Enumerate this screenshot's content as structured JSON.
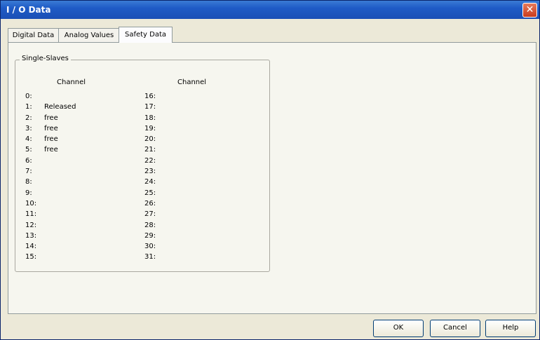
{
  "window": {
    "title": "I / O Data"
  },
  "tabs": [
    {
      "label": "Digital Data"
    },
    {
      "label": "Analog Values"
    },
    {
      "label": "Safety Data"
    }
  ],
  "group": {
    "label": "Single-Slaves"
  },
  "columns": [
    {
      "header": "Channel"
    },
    {
      "header": "Channel"
    }
  ],
  "left_rows": [
    {
      "num": "0:",
      "value": ""
    },
    {
      "num": "1:",
      "value": "Released"
    },
    {
      "num": "2:",
      "value": "free"
    },
    {
      "num": "3:",
      "value": "free"
    },
    {
      "num": "4:",
      "value": "free"
    },
    {
      "num": "5:",
      "value": "free"
    },
    {
      "num": "6:",
      "value": ""
    },
    {
      "num": "7:",
      "value": ""
    },
    {
      "num": "8:",
      "value": ""
    },
    {
      "num": "9:",
      "value": ""
    },
    {
      "num": "10:",
      "value": ""
    },
    {
      "num": "11:",
      "value": ""
    },
    {
      "num": "12:",
      "value": ""
    },
    {
      "num": "13:",
      "value": ""
    },
    {
      "num": "14:",
      "value": ""
    },
    {
      "num": "15:",
      "value": ""
    }
  ],
  "right_rows": [
    {
      "num": "16:",
      "value": ""
    },
    {
      "num": "17:",
      "value": ""
    },
    {
      "num": "18:",
      "value": ""
    },
    {
      "num": "19:",
      "value": ""
    },
    {
      "num": "20:",
      "value": ""
    },
    {
      "num": "21:",
      "value": ""
    },
    {
      "num": "22:",
      "value": ""
    },
    {
      "num": "23:",
      "value": ""
    },
    {
      "num": "24:",
      "value": ""
    },
    {
      "num": "25:",
      "value": ""
    },
    {
      "num": "26:",
      "value": ""
    },
    {
      "num": "27:",
      "value": ""
    },
    {
      "num": "28:",
      "value": ""
    },
    {
      "num": "29:",
      "value": ""
    },
    {
      "num": "30:",
      "value": ""
    },
    {
      "num": "31:",
      "value": ""
    }
  ],
  "buttons": {
    "ok": "OK",
    "cancel": "Cancel",
    "help": "Help"
  }
}
